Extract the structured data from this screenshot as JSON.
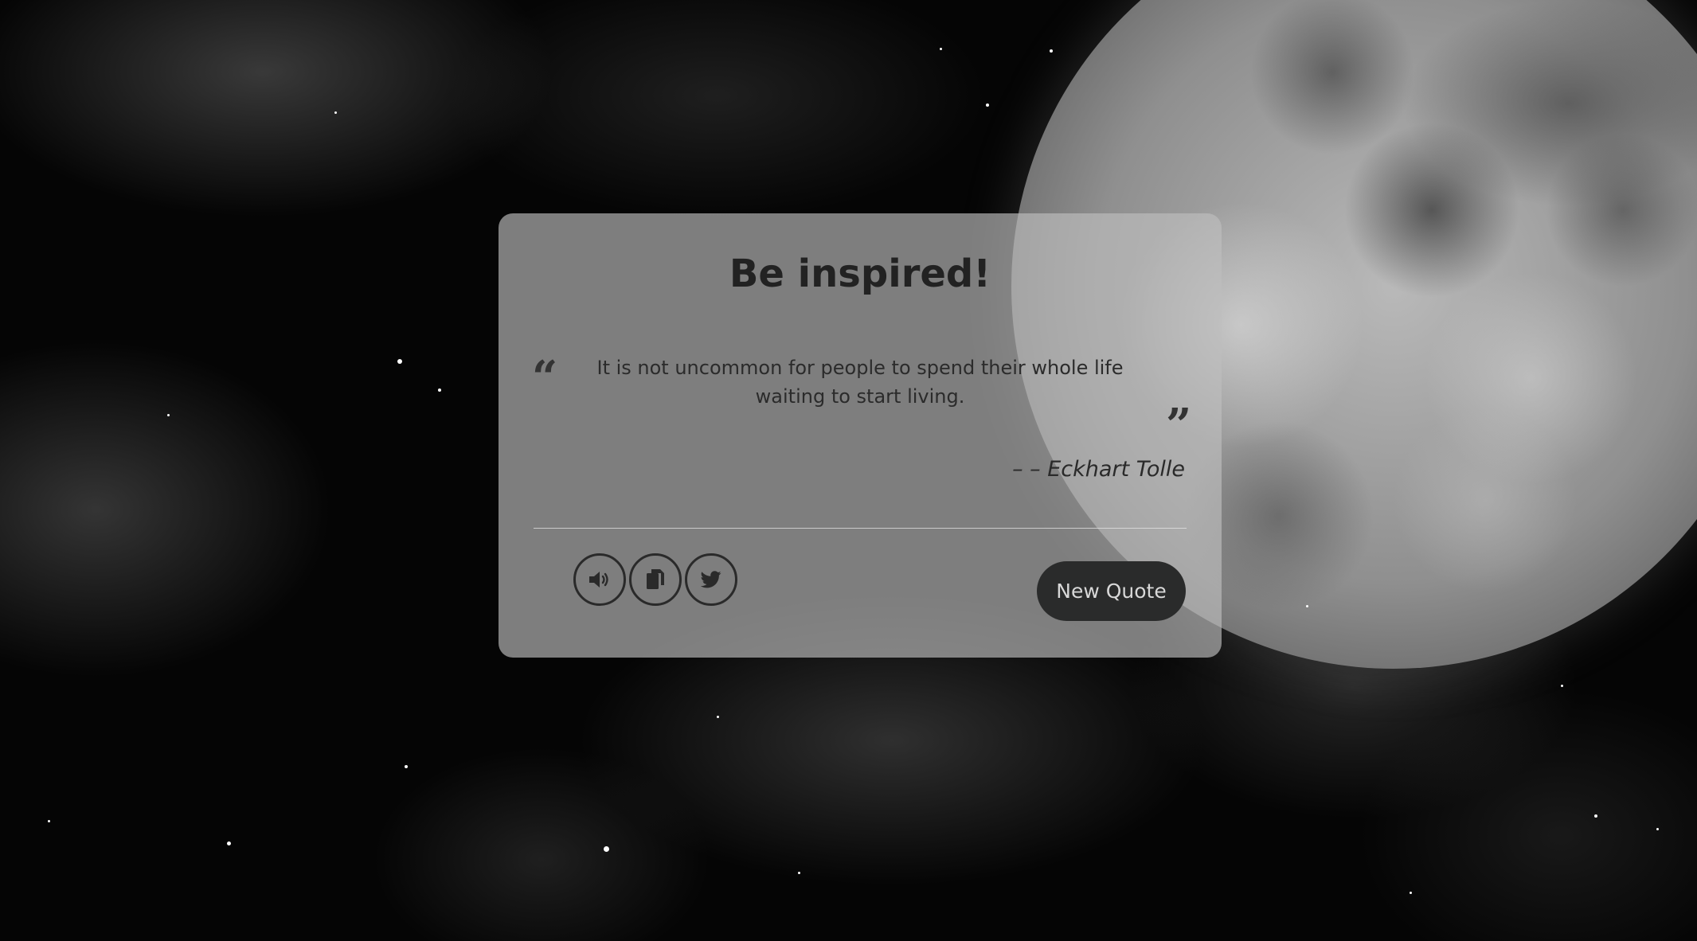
{
  "page": {
    "title": "Be inspired!"
  },
  "quote": {
    "open_mark": "“",
    "text": "It is not uncommon for people to spend their whole life waiting to start living.",
    "close_mark": "”",
    "author": "– – Eckhart Tolle"
  },
  "actions": {
    "speak_icon": "speaker-icon",
    "copy_icon": "copy-icon",
    "tweet_icon": "twitter-icon",
    "new_quote_label": "New Quote"
  },
  "colors": {
    "card_background": "#bebebe",
    "button_dark": "#2a2b2b",
    "button_text": "#d8d8d8",
    "text_dark": "#222222"
  }
}
